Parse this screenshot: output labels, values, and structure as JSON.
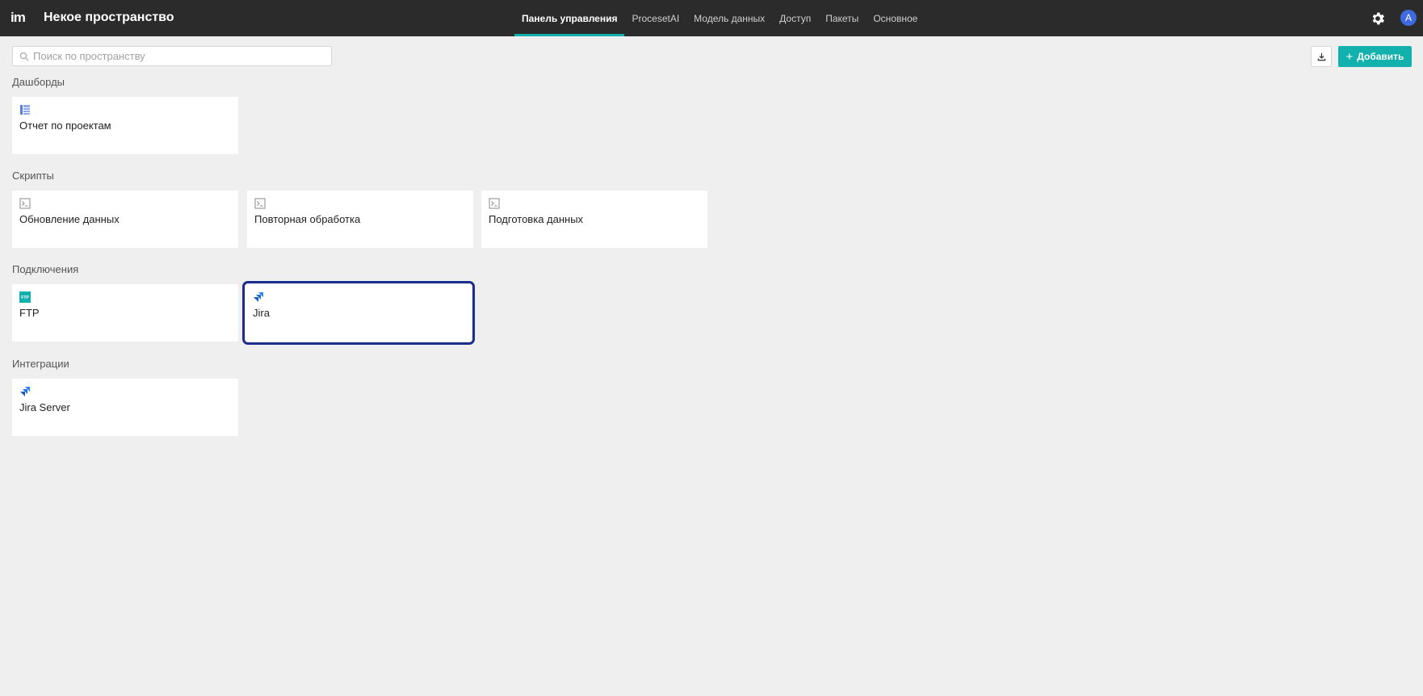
{
  "header": {
    "logo": "im",
    "space_title": "Некое пространство",
    "nav": [
      {
        "label": "Панель управления",
        "active": true
      },
      {
        "label": "ProcesetAI",
        "active": false
      },
      {
        "label": "Модель данных",
        "active": false
      },
      {
        "label": "Доступ",
        "active": false
      },
      {
        "label": "Пакеты",
        "active": false
      },
      {
        "label": "Основное",
        "active": false
      }
    ],
    "avatar_initial": "A"
  },
  "toolbar": {
    "search_placeholder": "Поиск по пространству",
    "add_label": "Добавить",
    "add_plus": "+"
  },
  "sections": {
    "dashboards": {
      "title": "Дашборды",
      "items": [
        {
          "label": "Отчет по проектам",
          "icon": "dashboard-icon"
        }
      ]
    },
    "scripts": {
      "title": "Скрипты",
      "items": [
        {
          "label": "Обновление данных",
          "icon": "script-icon"
        },
        {
          "label": "Повторная обработка",
          "icon": "script-icon"
        },
        {
          "label": "Подготовка данных",
          "icon": "script-icon"
        }
      ]
    },
    "connections": {
      "title": "Подключения",
      "items": [
        {
          "label": "FTP",
          "icon": "ftp-icon",
          "badge": "FTP"
        },
        {
          "label": "Jira",
          "icon": "jira-icon",
          "selected": true
        }
      ]
    },
    "integrations": {
      "title": "Интеграции",
      "items": [
        {
          "label": "Jira Server",
          "icon": "jira-icon"
        }
      ]
    }
  },
  "colors": {
    "accent": "#12b1ad",
    "topbar": "#2b2b2b",
    "selected_border": "#1b2e8c",
    "jira": "#2684ff",
    "avatar": "#3e6ae0"
  }
}
